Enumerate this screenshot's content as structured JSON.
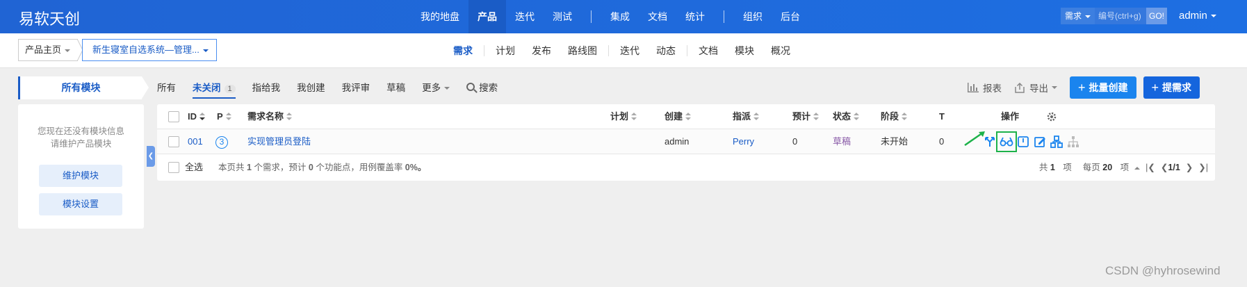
{
  "app": {
    "brand": "易软天创",
    "nav": [
      {
        "label": "我的地盘",
        "active": false
      },
      {
        "label": "产品",
        "active": true
      },
      {
        "label": "迭代",
        "active": false
      },
      {
        "label": "测试",
        "active": false
      },
      {
        "label": "集成",
        "active": false
      },
      {
        "label": "文档",
        "active": false
      },
      {
        "label": "统计",
        "active": false
      },
      {
        "label": "组织",
        "active": false
      },
      {
        "label": "后台",
        "active": false
      }
    ],
    "search": {
      "type": "需求",
      "placeholder": "编号(ctrl+g)",
      "go": "GO!"
    },
    "user": "admin"
  },
  "subbar": {
    "crumb_home": "产品主页",
    "crumb_product": "新生寝室自选系统—管理...",
    "tabs": [
      {
        "label": "需求",
        "active": true
      },
      {
        "label": "计划"
      },
      {
        "label": "发布"
      },
      {
        "label": "路线图"
      },
      {
        "label": "迭代"
      },
      {
        "label": "动态"
      },
      {
        "label": "文档"
      },
      {
        "label": "模块"
      },
      {
        "label": "概况"
      }
    ]
  },
  "left": {
    "module_tab": "所有模块",
    "empty_line1": "您现在还没有模块信息",
    "empty_line2": "请维护产品模块",
    "maintain_btn": "维护模块",
    "settings_btn": "模块设置"
  },
  "filters": {
    "all": "所有",
    "unclosed": "未关闭",
    "unclosed_count": "1",
    "assigned": "指给我",
    "created": "我创建",
    "review": "我评审",
    "draft": "草稿",
    "more": "更多",
    "search": "搜索"
  },
  "tools": {
    "report": "报表",
    "export": "导出",
    "batch_create": "批量创建",
    "create": "提需求"
  },
  "table": {
    "headers": {
      "id": "ID",
      "p": "P",
      "name": "需求名称",
      "plan": "计划",
      "creator": "创建",
      "assignee": "指派",
      "estimate": "预计",
      "status": "状态",
      "stage": "阶段",
      "t": "T",
      "actions": "操作"
    },
    "rows": [
      {
        "id": "001",
        "pri": "3",
        "name": "实现管理员登陆",
        "plan": "",
        "creator": "admin",
        "assignee": "Perry",
        "estimate": "0",
        "status": "草稿",
        "stage": "未开始",
        "t": "0"
      }
    ],
    "footer": {
      "select_all": "全选",
      "summary_prefix": "本页共 ",
      "summary_stories": "1",
      "summary_mid": " 个需求，预计 ",
      "summary_points": "0",
      "summary_suffix": " 个功能点，用例覆盖率 ",
      "summary_cov": "0%。",
      "total_prefix": "共 ",
      "total": "1",
      "total_suffix": " 项",
      "per_page_prefix": "每页 ",
      "per_page": "20",
      "per_page_suffix": " 项",
      "page": "1/1"
    }
  },
  "colors": {
    "accent": "#1a5cc6",
    "topbar": "#1e6fe2",
    "highlight": "#1db24a"
  },
  "watermark": "CSDN @hyhrosewind"
}
